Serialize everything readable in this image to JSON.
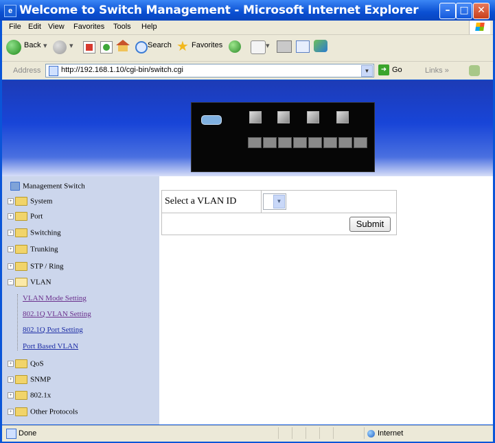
{
  "window": {
    "title": "Welcome to Switch Management - Microsoft Internet Explorer",
    "min_glyph": "–",
    "max_glyph": "□",
    "close_glyph": "✕"
  },
  "menu": {
    "items": [
      "File",
      "Edit",
      "View",
      "Favorites",
      "Tools",
      "Help"
    ]
  },
  "toolbar": {
    "back_label": "Back",
    "search_label": "Search",
    "favorites_label": "Favorites"
  },
  "address": {
    "label": "Address",
    "url": "http://192.168.1.10/cgi-bin/switch.cgi",
    "go_label": "Go",
    "links_label": "Links »"
  },
  "sidebar": {
    "root": "Management Switch",
    "items": [
      {
        "label": "System"
      },
      {
        "label": "Port"
      },
      {
        "label": "Switching"
      },
      {
        "label": "Trunking"
      },
      {
        "label": "STP / Ring"
      },
      {
        "label": "VLAN",
        "expanded": true
      },
      {
        "label": "QoS"
      },
      {
        "label": "SNMP"
      },
      {
        "label": "802.1x"
      },
      {
        "label": "Other Protocols"
      }
    ],
    "vlan_sublinks": [
      "VLAN Mode Setting",
      "802.1Q VLAN Setting",
      "802.1Q Port Setting",
      "Port Based VLAN"
    ]
  },
  "form": {
    "select_label": "Select a VLAN ID",
    "vlan_select_value": "",
    "submit_label": "Submit"
  },
  "status": {
    "text": "Done",
    "zone": "Internet"
  }
}
